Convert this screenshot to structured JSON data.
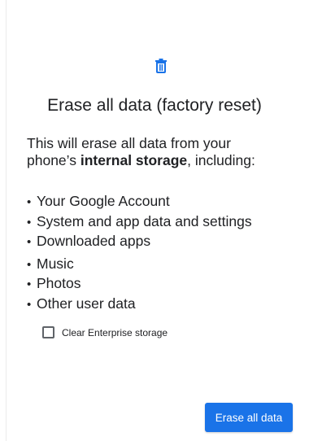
{
  "dialog": {
    "icon": "trash-icon",
    "title": "Erase all data (factory reset)",
    "description": {
      "line1": "This will erase all data from your",
      "line2_prefix": "phone’s ",
      "line2_bold": "internal storage",
      "line2_suffix": ", including:"
    },
    "items": [
      "Your Google Account",
      "System and app data and settings",
      "Downloaded apps",
      "Music",
      "Photos",
      "Other user data"
    ],
    "bullet": "•",
    "checkbox": {
      "label": "Clear Enterprise storage",
      "checked": false
    },
    "primary_button": "Erase all data"
  },
  "colors": {
    "accent": "#1a73e8",
    "text": "#202124"
  }
}
